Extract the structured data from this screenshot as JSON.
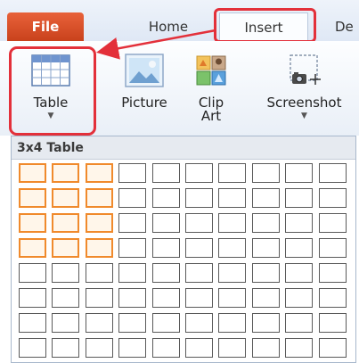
{
  "tabs": {
    "file": "File",
    "home": "Home",
    "insert": "Insert",
    "partial": "De"
  },
  "ribbon": {
    "table": {
      "label": "Table",
      "icon": "table-icon"
    },
    "picture": {
      "label": "Picture",
      "icon": "picture-icon"
    },
    "clipart": {
      "label_line1": "Clip",
      "label_line2": "Art",
      "icon": "clip-art-icon"
    },
    "screenshot": {
      "label": "Screenshot",
      "icon": "screenshot-icon"
    }
  },
  "table_picker": {
    "header": "3x4 Table",
    "columns": 10,
    "rows": 8,
    "selected_columns": 3,
    "selected_rows": 4
  },
  "colors": {
    "file_tab": "#d84f26",
    "highlight": "#e3303a",
    "cell_selected": "#f08a2c"
  }
}
